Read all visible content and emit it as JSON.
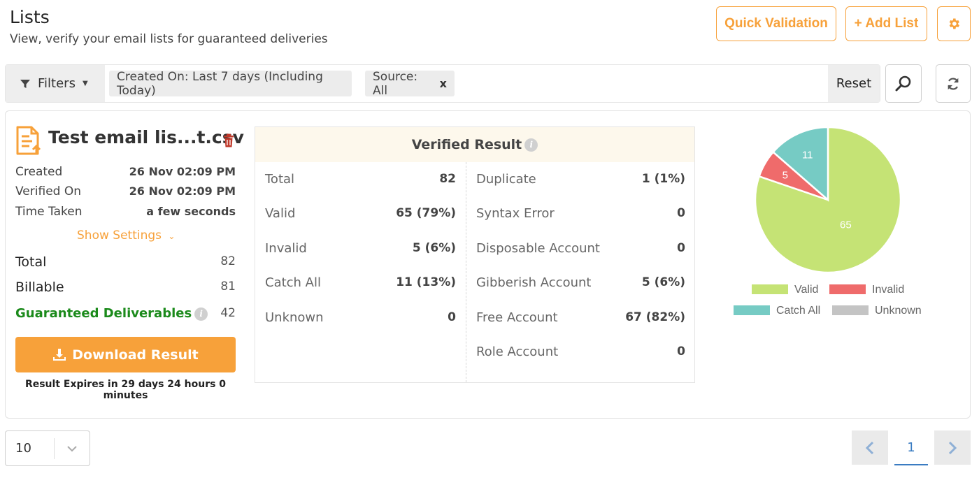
{
  "header": {
    "title": "Lists",
    "subtitle": "View, verify your email lists for guaranteed deliveries",
    "quick_validation": "Quick Validation",
    "add_list": "+ Add List",
    "settings_icon": "gear-icon"
  },
  "filters": {
    "label": "Filters",
    "chips": [
      {
        "text": "Created On: Last 7 days (Including Today)"
      },
      {
        "text": "Source: All",
        "close": "x"
      }
    ],
    "reset": "Reset"
  },
  "list": {
    "file_name": "Test email lis...t.csv",
    "created_label": "Created",
    "created_value": "26 Nov 02:09 PM",
    "verified_label": "Verified On",
    "verified_value": "26 Nov 02:09 PM",
    "time_label": "Time Taken",
    "time_value": "a few seconds",
    "show_settings": "Show Settings",
    "total_label": "Total",
    "total_value": "82",
    "billable_label": "Billable",
    "billable_value": "81",
    "guaranteed_label": "Guaranteed Deliverables",
    "guaranteed_value": "42",
    "download": "Download Result",
    "expires": "Result Expires in 29 days 24 hours 0 minutes"
  },
  "verified": {
    "title": "Verified Result",
    "left": [
      {
        "label": "Total",
        "value": "82"
      },
      {
        "label": "Valid",
        "value": "65 (79%)"
      },
      {
        "label": "Invalid",
        "value": "5 (6%)"
      },
      {
        "label": "Catch All",
        "value": "11 (13%)"
      },
      {
        "label": "Unknown",
        "value": "0"
      }
    ],
    "right": [
      {
        "label": "Duplicate",
        "value": "1 (1%)"
      },
      {
        "label": "Syntax Error",
        "value": "0"
      },
      {
        "label": "Disposable Account",
        "value": "0"
      },
      {
        "label": "Gibberish Account",
        "value": "5 (6%)"
      },
      {
        "label": "Free Account",
        "value": "67 (82%)"
      },
      {
        "label": "Role Account",
        "value": "0"
      }
    ]
  },
  "chart_data": {
    "type": "pie",
    "categories": [
      "Valid",
      "Invalid",
      "Catch All",
      "Unknown"
    ],
    "values": [
      65,
      5,
      11,
      0
    ],
    "colors": [
      "#c5e375",
      "#ef6b6b",
      "#76cbc4",
      "#c4c4c4"
    ],
    "legend": "bottom"
  },
  "pagination": {
    "page_size": "10",
    "current_page": "1"
  }
}
